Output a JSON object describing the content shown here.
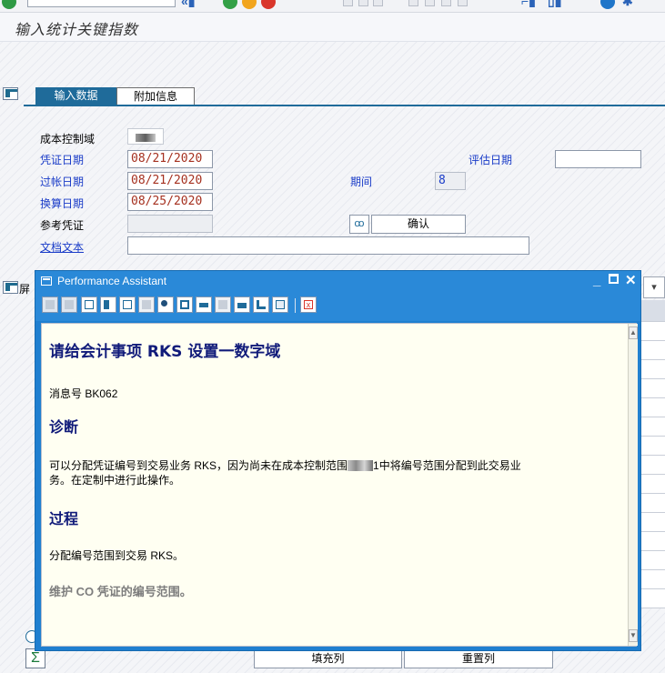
{
  "page": {
    "title": "输入统计关键指数"
  },
  "tabs": [
    {
      "label": "输入数据",
      "active": true
    },
    {
      "label": "附加信息",
      "active": false
    }
  ],
  "form": {
    "controlling_area": {
      "label": "成本控制域",
      "value": ""
    },
    "document_date": {
      "label": "凭证日期",
      "value": "08/21/2020"
    },
    "posting_date": {
      "label": "过帐日期",
      "value": "08/21/2020"
    },
    "translation_date": {
      "label": "换算日期",
      "value": "08/25/2020"
    },
    "reference": {
      "label": "参考凭证",
      "value": ""
    },
    "doc_text": {
      "label": "文档文本",
      "value": ""
    },
    "valuation_date": {
      "label": "评估日期",
      "value": ""
    },
    "period": {
      "label": "期间",
      "value": "8"
    },
    "confirm_label": "确认"
  },
  "lower": {
    "tab_label_partial": "屏",
    "fill_label": "填充列",
    "reset_label": "重置列"
  },
  "dialog": {
    "title": "Performance Assistant",
    "heading": "请给会计事项 RKS 设置一数字域",
    "message_no": "消息号 BK062",
    "diagnosis_heading": "诊断",
    "diagnosis_pre": "可以分配凭证编号到交易业务 RKS，因为尚未在成本控制范围",
    "diagnosis_mid": "1",
    "diagnosis_post": "中将编号范围分配到此交易业",
    "diagnosis_line2": "务。在定制中进行此操作。",
    "procedure_heading": "过程",
    "procedure_text": "分配编号范围到交易 RKS。",
    "link_text": "维护 CO 凭证的编号范围。"
  },
  "colors": {
    "accent": "#1f6b9a",
    "dialog_frame": "#1f7fd0",
    "heading": "#111b7a",
    "required_label": "#1a3cc8",
    "date_value": "#a5301f"
  },
  "icons": [
    "dialog-icon",
    "back-icon",
    "forward-icon",
    "minimize-icon",
    "maximize-icon",
    "close-icon",
    "glasses-icon",
    "sigma-icon"
  ]
}
